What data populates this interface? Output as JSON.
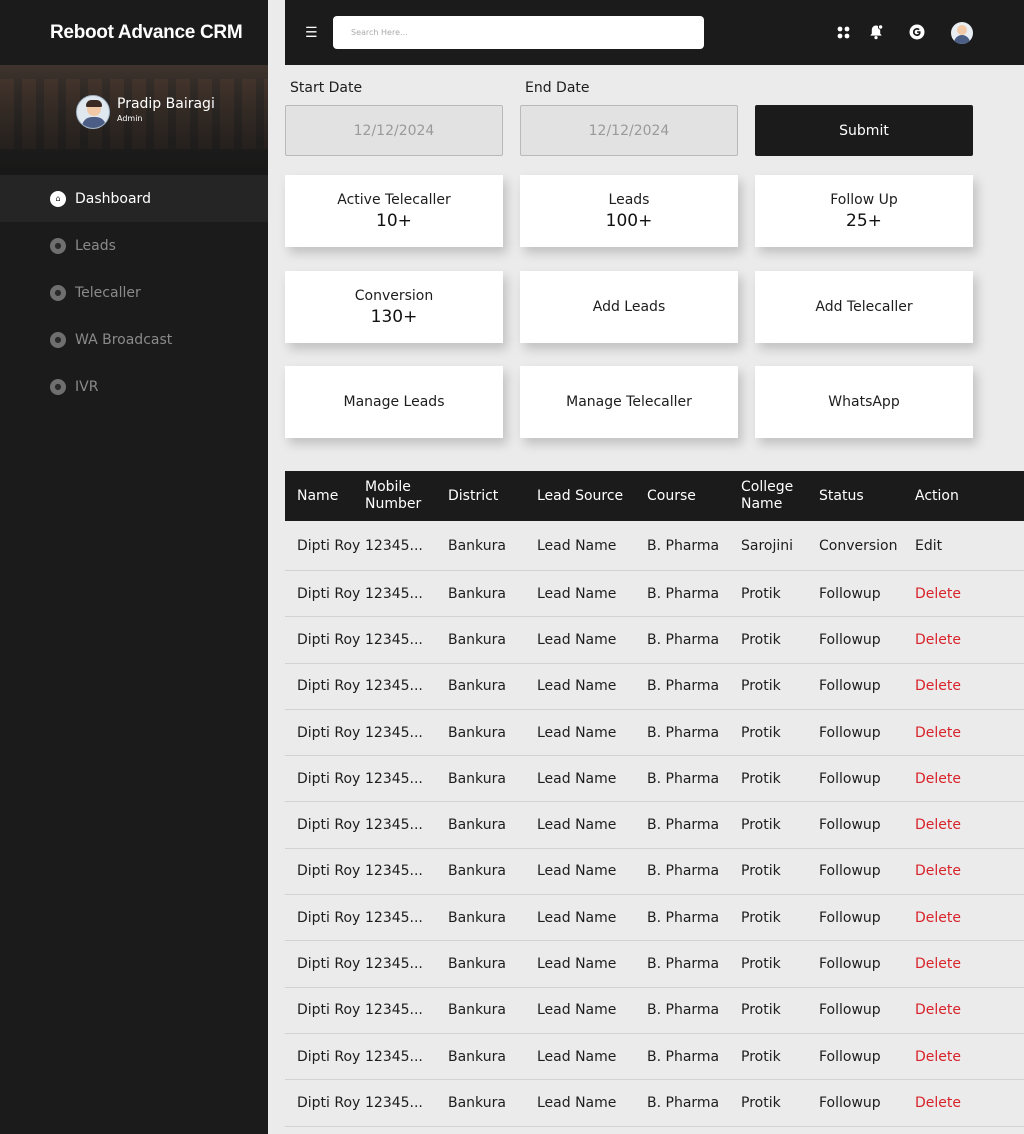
{
  "app": {
    "title": "Reboot Advance CRM"
  },
  "profile": {
    "name": "Pradip Bairagi",
    "role": "Admin"
  },
  "sidebar": {
    "items": [
      {
        "label": "Dashboard",
        "icon": "home-icon",
        "active": true
      },
      {
        "label": "Leads",
        "icon": "leads-icon",
        "active": false
      },
      {
        "label": "Telecaller",
        "icon": "telecaller-icon",
        "active": false
      },
      {
        "label": "WA Broadcast",
        "icon": "broadcast-icon",
        "active": false
      },
      {
        "label": "IVR",
        "icon": "ivr-icon",
        "active": false
      }
    ]
  },
  "topbar": {
    "search_placeholder": "Search Here..."
  },
  "filters": {
    "start_label": "Start Date",
    "start_value": "12/12/2024",
    "end_label": "End Date",
    "end_value": "12/12/2024",
    "submit_label": "Submit"
  },
  "cards": [
    {
      "title": "Active Telecaller",
      "value": "10+"
    },
    {
      "title": "Leads",
      "value": "100+"
    },
    {
      "title": "Follow Up",
      "value": "25+"
    },
    {
      "title": "Conversion",
      "value": "130+"
    },
    {
      "title": "Add Leads",
      "value": ""
    },
    {
      "title": "Add Telecaller",
      "value": ""
    },
    {
      "title": "Manage Leads",
      "value": ""
    },
    {
      "title": "Manage Telecaller",
      "value": ""
    },
    {
      "title": "WhatsApp",
      "value": ""
    }
  ],
  "table": {
    "headers": [
      "Name",
      "Mobile Number",
      "District",
      "Lead Source",
      "Course",
      "College Name",
      "Status",
      "Action"
    ],
    "rows": [
      [
        "Dipti Roy",
        "12345...",
        "Bankura",
        "Lead Name",
        "B. Pharma",
        "Sarojini",
        "Conversion",
        "Edit"
      ],
      [
        "Dipti Roy",
        "12345...",
        "Bankura",
        "Lead Name",
        "B. Pharma",
        "Protik",
        "Followup",
        "Delete"
      ],
      [
        "Dipti Roy",
        "12345...",
        "Bankura",
        "Lead Name",
        "B. Pharma",
        "Protik",
        "Followup",
        "Delete"
      ],
      [
        "Dipti Roy",
        "12345...",
        "Bankura",
        "Lead Name",
        "B. Pharma",
        "Protik",
        "Followup",
        "Delete"
      ],
      [
        "Dipti Roy",
        "12345...",
        "Bankura",
        "Lead Name",
        "B. Pharma",
        "Protik",
        "Followup",
        "Delete"
      ],
      [
        "Dipti Roy",
        "12345...",
        "Bankura",
        "Lead Name",
        "B. Pharma",
        "Protik",
        "Followup",
        "Delete"
      ],
      [
        "Dipti Roy",
        "12345...",
        "Bankura",
        "Lead Name",
        "B. Pharma",
        "Protik",
        "Followup",
        "Delete"
      ],
      [
        "Dipti Roy",
        "12345...",
        "Bankura",
        "Lead Name",
        "B. Pharma",
        "Protik",
        "Followup",
        "Delete"
      ],
      [
        "Dipti Roy",
        "12345...",
        "Bankura",
        "Lead Name",
        "B. Pharma",
        "Protik",
        "Followup",
        "Delete"
      ],
      [
        "Dipti Roy",
        "12345...",
        "Bankura",
        "Lead Name",
        "B. Pharma",
        "Protik",
        "Followup",
        "Delete"
      ],
      [
        "Dipti Roy",
        "12345...",
        "Bankura",
        "Lead Name",
        "B. Pharma",
        "Protik",
        "Followup",
        "Delete"
      ],
      [
        "Dipti Roy",
        "12345...",
        "Bankura",
        "Lead Name",
        "B. Pharma",
        "Protik",
        "Followup",
        "Delete"
      ],
      [
        "Dipti Roy",
        "12345...",
        "Bankura",
        "Lead Name",
        "B. Pharma",
        "Protik",
        "Followup",
        "Delete"
      ]
    ]
  },
  "colors": {
    "dark": "#1b1b1c",
    "background": "#ebebeb",
    "delete": "#d8232a"
  },
  "icons": {
    "menu": "list-icon",
    "apps": "apps-grid-icon",
    "notifications": "bell-icon",
    "google": "google-icon"
  }
}
